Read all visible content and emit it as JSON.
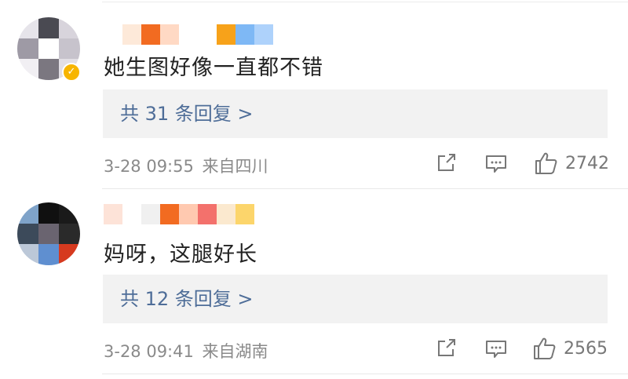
{
  "comments": [
    {
      "text": "她生图好像一直都不错",
      "reply_label": "共 31 条回复 >",
      "date": "3-28 09:55",
      "location": "来自四川",
      "likes": "2742",
      "verified": true,
      "avatar_colors": [
        "#e6e4ea",
        "#4a4a52",
        "#d8d4dc",
        "#9e9aa5",
        "#ffffff",
        "#c7c3cc",
        "#f1eff3",
        "#7b7780",
        "#e2dfe5"
      ],
      "name_colors": [
        "#ffffff",
        "#fde9d9",
        "#f26b21",
        "#ffd9c4",
        "#ffffff",
        "#ffffff",
        "#f7a21a",
        "#7eb8f5",
        "#aed2fb"
      ]
    },
    {
      "text": "妈呀，这腿好长",
      "reply_label": "共 12 条回复 >",
      "date": "3-28 09:41",
      "location": "来自湖南",
      "likes": "2565",
      "verified": false,
      "avatar_colors": [
        "#7fa3c9",
        "#101010",
        "#1a1a1a",
        "#3c4a5a",
        "#6a6470",
        "#2a2a2a",
        "#bcc8d8",
        "#5f8fd0",
        "#d63a1f"
      ],
      "name_colors": [
        "#fde3d8",
        "#ffffff",
        "#f0f0f0",
        "#f26b21",
        "#ffc9b0",
        "#f3716c",
        "#fbe9cf",
        "#fcd56b"
      ]
    }
  ],
  "icons": {
    "share": "share-icon",
    "comment": "comment-icon",
    "like": "thumb-up-icon"
  },
  "colors": {
    "link": "#4e6d98",
    "meta": "#8a8a8a",
    "reply_bg": "#f2f2f2",
    "verified": "#f7b500"
  }
}
